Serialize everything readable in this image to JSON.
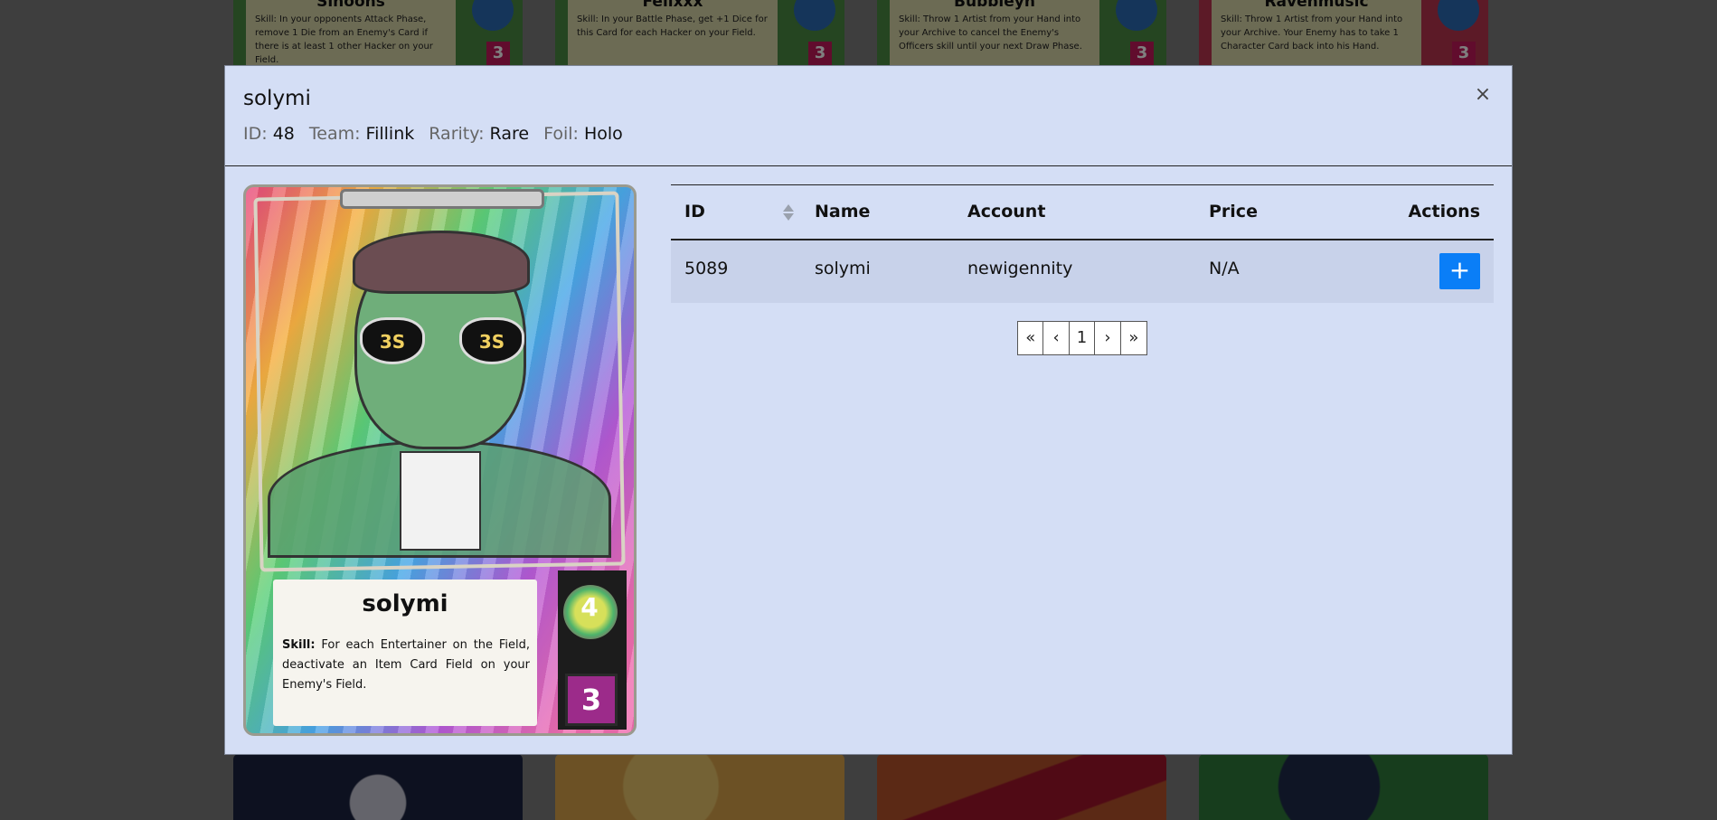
{
  "background_cards": [
    {
      "title": "Sinoons",
      "skill": "Skill: In your opponents Attack Phase, remove 1 Die from an Enemy's Card if there is at least 1 other Hacker on your Field."
    },
    {
      "title": "Felixxx",
      "skill": "Skill: In your Battle Phase, get +1 Dice for this Card for each Hacker on your Field."
    },
    {
      "title": "Bubbleyn",
      "skill": "Skill: Throw 1 Artist from your Hand into your Archive to cancel the Enemy's Officers skill until your next Draw Phase."
    },
    {
      "title": "Ravenmusic",
      "skill": "Skill: Throw 1 Artist from your Hand into your Archive. Your Enemy has to take 1 Character Card back into his Hand."
    }
  ],
  "modal": {
    "title": "solymi",
    "meta": {
      "id_label": "ID:",
      "id_value": "48",
      "team_label": "Team:",
      "team_value": "Fillink",
      "rarity_label": "Rarity:",
      "rarity_value": "Rare",
      "foil_label": "Foil:",
      "foil_value": "Holo"
    },
    "close_label": "×",
    "card": {
      "name": "solymi",
      "skill_label": "Skill:",
      "skill_text": "For each Entertainer on the Field, deactivate an Item Card Field on your Enemy's Field.",
      "power": "4",
      "cost": "3",
      "lens_text": "3S"
    },
    "table": {
      "headers": {
        "id": "ID",
        "name": "Name",
        "account": "Account",
        "price": "Price",
        "actions": "Actions"
      },
      "rows": [
        {
          "id": "5089",
          "name": "solymi",
          "account": "newigennity",
          "price": "N/A",
          "action_label": "+"
        }
      ]
    },
    "pagination": {
      "first": "«",
      "prev": "‹",
      "current": "1",
      "next": "›",
      "last": "»"
    }
  },
  "colors": {
    "modal_bg": "#d4def5",
    "row_bg": "#c8d2ea",
    "button_blue": "#0a7ef7"
  }
}
